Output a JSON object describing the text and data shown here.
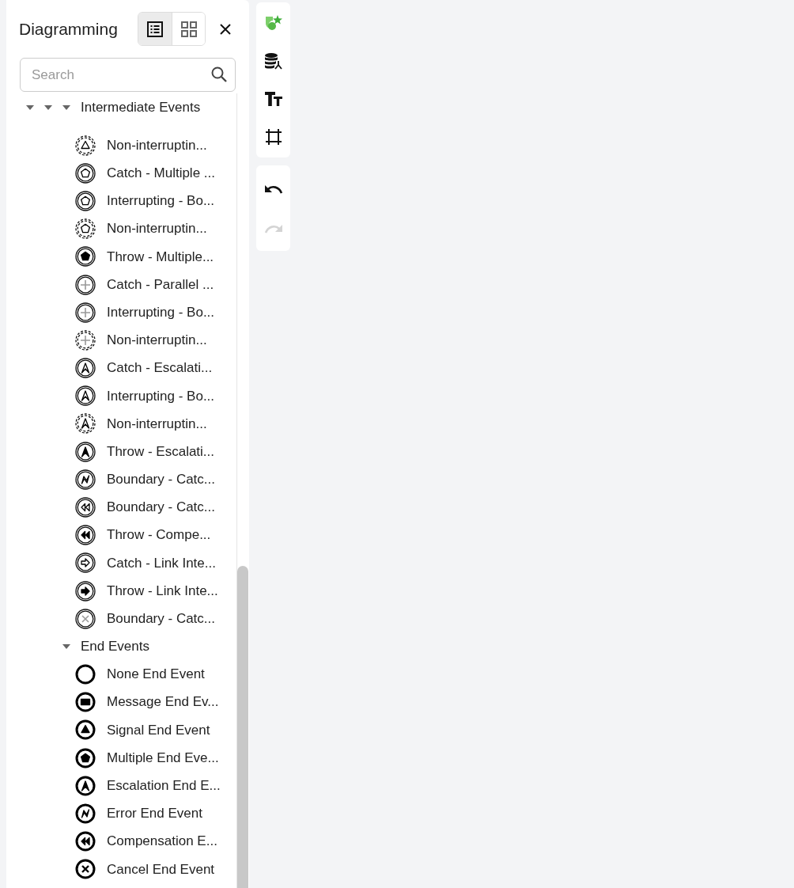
{
  "panel": {
    "title": "Diagramming",
    "views": [
      {
        "kind": "list",
        "selected": true
      },
      {
        "kind": "grid",
        "selected": false
      }
    ],
    "search": {
      "placeholder": "Search"
    },
    "tree": [
      {
        "expanded": true,
        "children": [
          {
            "expanded": true,
            "children": [
              {
                "label": "Intermediate Events",
                "expanded": true,
                "children": [
                  {
                    "label": "Non-interruptin...",
                    "kind": "dashedSignal"
                  },
                  {
                    "label": "Catch - Multiple ...",
                    "kind": "multiple"
                  },
                  {
                    "label": "Interrupting - Bo...",
                    "kind": "multiple"
                  },
                  {
                    "label": "Non-interruptin...",
                    "kind": "dashedMultiple"
                  },
                  {
                    "label": "Throw - Multiple...",
                    "kind": "throwMultiple"
                  },
                  {
                    "label": "Catch - Parallel ...",
                    "kind": "parallel"
                  },
                  {
                    "label": "Interrupting - Bo...",
                    "kind": "parallel"
                  },
                  {
                    "label": "Non-interruptin...",
                    "kind": "dashedParallel"
                  },
                  {
                    "label": "Catch - Escalati...",
                    "kind": "escalation"
                  },
                  {
                    "label": "Interrupting - Bo...",
                    "kind": "escalation"
                  },
                  {
                    "label": "Non-interruptin...",
                    "kind": "dashedEscalation"
                  },
                  {
                    "label": "Throw - Escalati...",
                    "kind": "throwEscalation"
                  },
                  {
                    "label": "Boundary - Catc...",
                    "kind": "error"
                  },
                  {
                    "label": "Boundary - Catc...",
                    "kind": "compensation"
                  },
                  {
                    "label": "Throw - Compe...",
                    "kind": "throwCompensation"
                  },
                  {
                    "label": "Catch - Link Inte...",
                    "kind": "link"
                  },
                  {
                    "label": "Throw - Link Inte...",
                    "kind": "throwLink"
                  },
                  {
                    "label": "Boundary - Catc...",
                    "kind": "cancel"
                  }
                ]
              },
              {
                "label": "End Events",
                "expanded": true,
                "children": [
                  {
                    "label": "None End Event",
                    "kind": "endNone"
                  },
                  {
                    "label": "Message End Ev...",
                    "kind": "endMessage"
                  },
                  {
                    "label": "Signal End Event",
                    "kind": "endSignal"
                  },
                  {
                    "label": "Multiple End Eve...",
                    "kind": "endMultiple"
                  },
                  {
                    "label": "Escalation End E...",
                    "kind": "endEscalation"
                  },
                  {
                    "label": "Error End Event",
                    "kind": "endError"
                  },
                  {
                    "label": "Compensation E...",
                    "kind": "endCompensation"
                  },
                  {
                    "label": "Cancel End Event",
                    "kind": "endCancel"
                  }
                ]
              }
            ]
          }
        ]
      }
    ]
  },
  "toolbar": {
    "tools": [
      {
        "kind": "shapes"
      },
      {
        "kind": "database"
      },
      {
        "kind": "text"
      },
      {
        "kind": "frame"
      }
    ],
    "history": [
      {
        "kind": "undo",
        "disabled": false
      },
      {
        "kind": "redo",
        "disabled": true
      }
    ]
  }
}
